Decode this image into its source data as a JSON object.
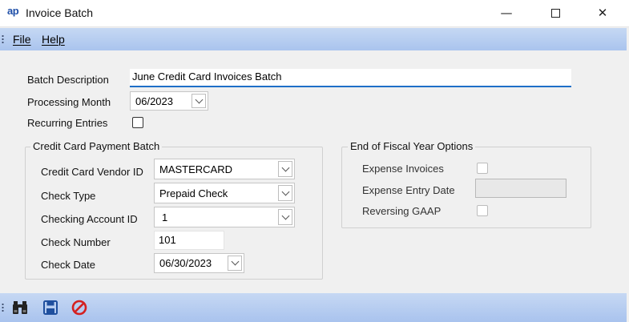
{
  "window": {
    "app_icon_text": "ap",
    "title": "Invoice Batch",
    "minimize_glyph": "—",
    "close_glyph": "✕"
  },
  "menu": {
    "items": [
      {
        "label": "File"
      },
      {
        "label": "Help"
      }
    ]
  },
  "form": {
    "batch_description": {
      "label": "Batch Description",
      "value": "June Credit Card Invoices Batch"
    },
    "processing_month": {
      "label": "Processing Month",
      "value": "06/2023"
    },
    "recurring_entries": {
      "label": "Recurring Entries",
      "checked": false
    }
  },
  "credit_card_group": {
    "title": "Credit Card Payment Batch",
    "vendor_id": {
      "label": "Credit Card Vendor ID",
      "value": "MASTERCARD"
    },
    "check_type": {
      "label": "Check Type",
      "value": "Prepaid Check"
    },
    "checking_account_id": {
      "label": "Checking Account ID",
      "value": "1"
    },
    "check_number": {
      "label": "Check Number",
      "value": "101"
    },
    "check_date": {
      "label": "Check Date",
      "value": "06/30/2023"
    }
  },
  "fiscal_group": {
    "title": "End of Fiscal Year Options",
    "expense_invoices": {
      "label": "Expense Invoices",
      "checked": false
    },
    "expense_entry_date": {
      "label": "Expense Entry Date",
      "value": ""
    },
    "reversing_gaap": {
      "label": "Reversing GAAP",
      "checked": false
    }
  },
  "toolbar": {
    "buttons": [
      {
        "icon": "binoculars-icon"
      },
      {
        "icon": "save-icon"
      },
      {
        "icon": "cancel-icon"
      }
    ]
  },
  "colors": {
    "menubar_bg": "#b8cef0",
    "focus_underline": "#1e6fc8",
    "cancel_red": "#d42020",
    "save_blue": "#1f4f9e"
  }
}
